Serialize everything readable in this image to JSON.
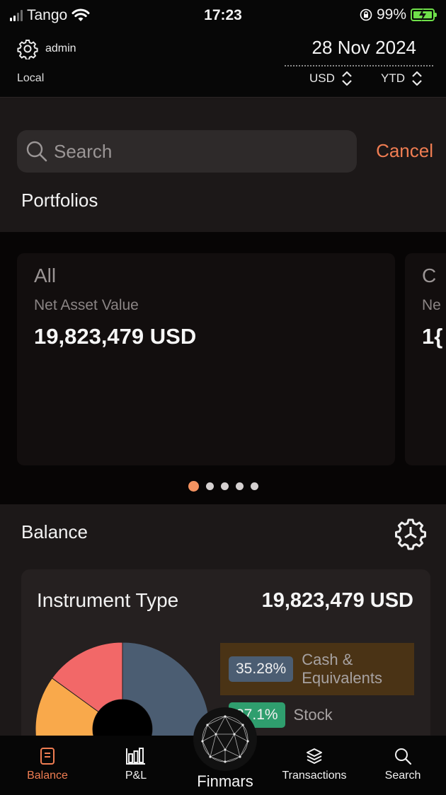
{
  "status_bar": {
    "carrier": "Tango",
    "time": "17:23",
    "battery_percent": "99%",
    "battery_level": 0.99
  },
  "header": {
    "user": "admin",
    "location": "Local",
    "date": "28 Nov 2024",
    "currency": "USD",
    "period": "YTD"
  },
  "search": {
    "placeholder": "Search",
    "cancel_label": "Cancel"
  },
  "portfolios": {
    "title": "Portfolios",
    "cards": [
      {
        "name": "All",
        "metric_label": "Net Asset Value",
        "value": "19,823,479 USD"
      },
      {
        "name": "C",
        "metric_label": "Ne",
        "value": "1{"
      }
    ],
    "page_count": 5,
    "active_page": 0
  },
  "balance": {
    "title": "Balance",
    "group_label": "Instrument Type",
    "total": "19,823,479 USD",
    "legend": [
      {
        "percent": "35.28%",
        "label_line1": "Cash &",
        "label_line2": "Equivalents",
        "color": "#4b5d72",
        "highlight": "#4a3315"
      },
      {
        "percent": "27.1%",
        "label_line1": "Stock",
        "label_line2": "",
        "color": "#2f9e6e",
        "highlight": ""
      }
    ]
  },
  "chart_data": {
    "type": "pie",
    "title": "Instrument Type",
    "categories": [
      "Cash & Equivalents",
      "Stock"
    ],
    "values": [
      35.28,
      27.1
    ],
    "colors": {
      "slate": "#4b5d72",
      "coral": "#f26868",
      "amber": "#f9a94b"
    }
  },
  "tabbar": {
    "items": [
      {
        "label": "Balance",
        "icon": "document-icon",
        "active": true
      },
      {
        "label": "P&L",
        "icon": "bar-chart-icon",
        "active": false
      },
      {
        "label": "Finmars",
        "icon": "globe-icon",
        "active": false
      },
      {
        "label": "Transactions",
        "icon": "layers-icon",
        "active": false
      },
      {
        "label": "Search",
        "icon": "search-icon",
        "active": false
      }
    ]
  },
  "colors": {
    "accent": "#f07d52",
    "background": "#1c1818",
    "dot_active": "#f39260"
  }
}
